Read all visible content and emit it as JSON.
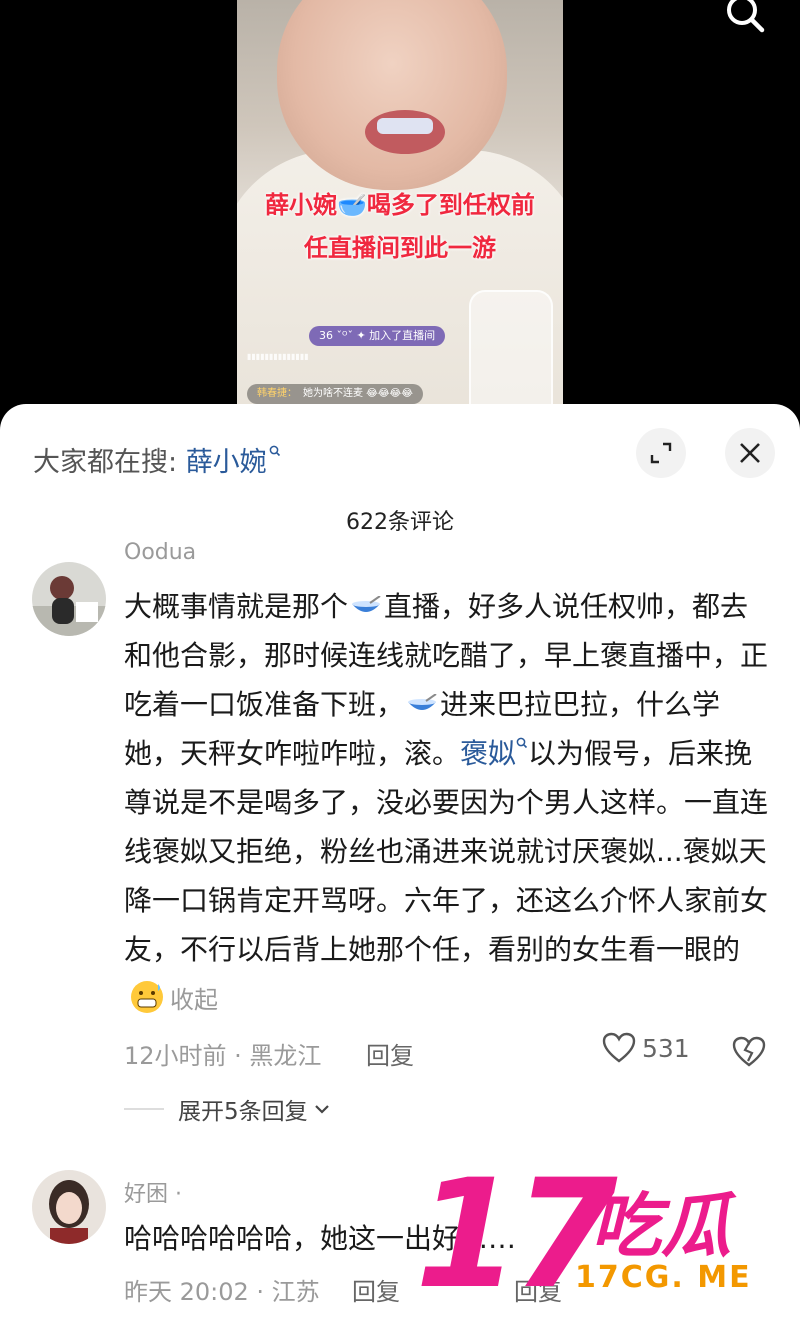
{
  "video": {
    "caption_line1": "薛小婉🥣喝多了到任权前",
    "caption_line2": "任直播间到此一游",
    "join_notice": "36 ˇᴼˇ ✦ 加入了直播间",
    "comment_nick": "韩春捷：",
    "comment_text": "她为啥不连麦 😂😂😂😂",
    "search_icon": "search-icon"
  },
  "sheet": {
    "search_prefix": "大家都在搜: ",
    "search_keyword": "薛小婉",
    "comment_count": "622条评论",
    "expand_icon": "expand-icon",
    "close_icon": "close-icon"
  },
  "comments": [
    {
      "name": "Oodua",
      "body_part1": "大概事情就是那个",
      "body_part2": "直播，好多人说任权帅，都去和他合影，那时候连线就吃醋了，早上褒直播中，正吃着一口饭准备下班，",
      "body_part3": "进来巴拉巴拉，什么学她，天秤女咋啦咋啦，滚。",
      "body_link": "褒姒",
      "body_part4": "以为假号，后来挽尊说是不是喝多了，没必要因为个男人这样。一直连线褒姒又拒绝，粉丝也涌进来说就讨厌褒姒...褒姒天降一口锅肯定开骂呀。六年了，还这么介怀人家前女友，不行以后背上她那个任，看别的女生看一眼的",
      "fold_label": "收起",
      "meta": "12小时前 · 黑龙江",
      "reply_label": "回复",
      "likes": "531",
      "expand_replies": "展开5条回复"
    },
    {
      "name": "好困 ·",
      "body": "哈哈哈哈哈哈，她这一出好……",
      "meta": "昨天 20:02 · 江苏",
      "reply_label": "回复",
      "reply_label2": "回复"
    }
  ],
  "watermark": {
    "number": "17",
    "chinese": "吃瓜",
    "url": "17CG. ME"
  },
  "colors": {
    "accent_link": "#2a5a9a",
    "caption_red": "#f0283f",
    "watermark_pink": "#ec1c8c",
    "watermark_orange": "#f39800"
  }
}
